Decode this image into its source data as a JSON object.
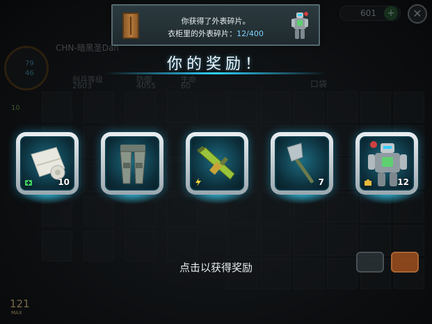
{
  "banner": {
    "line1": "你获得了外表碎片。",
    "line2_prefix": "衣柜里的外表碎片：",
    "line2_count": "12/400"
  },
  "title": "你的奖励！",
  "hint": "点击以获得奖励",
  "player": {
    "name": "CHN-暗黑圣Dan",
    "stat_a": "79",
    "stat_b": "46",
    "level": "10"
  },
  "background_stats": {
    "label1": "创兵等级",
    "value1": "2603",
    "label2": "防御",
    "value2": "4055",
    "label3": "生命",
    "value3": "60",
    "inventory_tab": "口袋"
  },
  "currency": {
    "value": "601"
  },
  "corner": {
    "number": "121",
    "label": "MAX"
  },
  "rewards": [
    {
      "item": "bandage",
      "quantity": "10",
      "badge": "medkit-icon"
    },
    {
      "item": "armor-pants",
      "quantity": "",
      "badge": ""
    },
    {
      "item": "assault-rifle",
      "quantity": "",
      "badge": "lightning-icon"
    },
    {
      "item": "axe",
      "quantity": "7",
      "badge": ""
    },
    {
      "item": "armor-appearance",
      "quantity": "12",
      "badge": "puzzle-icon"
    }
  ],
  "colors": {
    "accent": "#2fd0ff",
    "count": "#7fd2ff",
    "card_frame": "#e9eef1"
  }
}
